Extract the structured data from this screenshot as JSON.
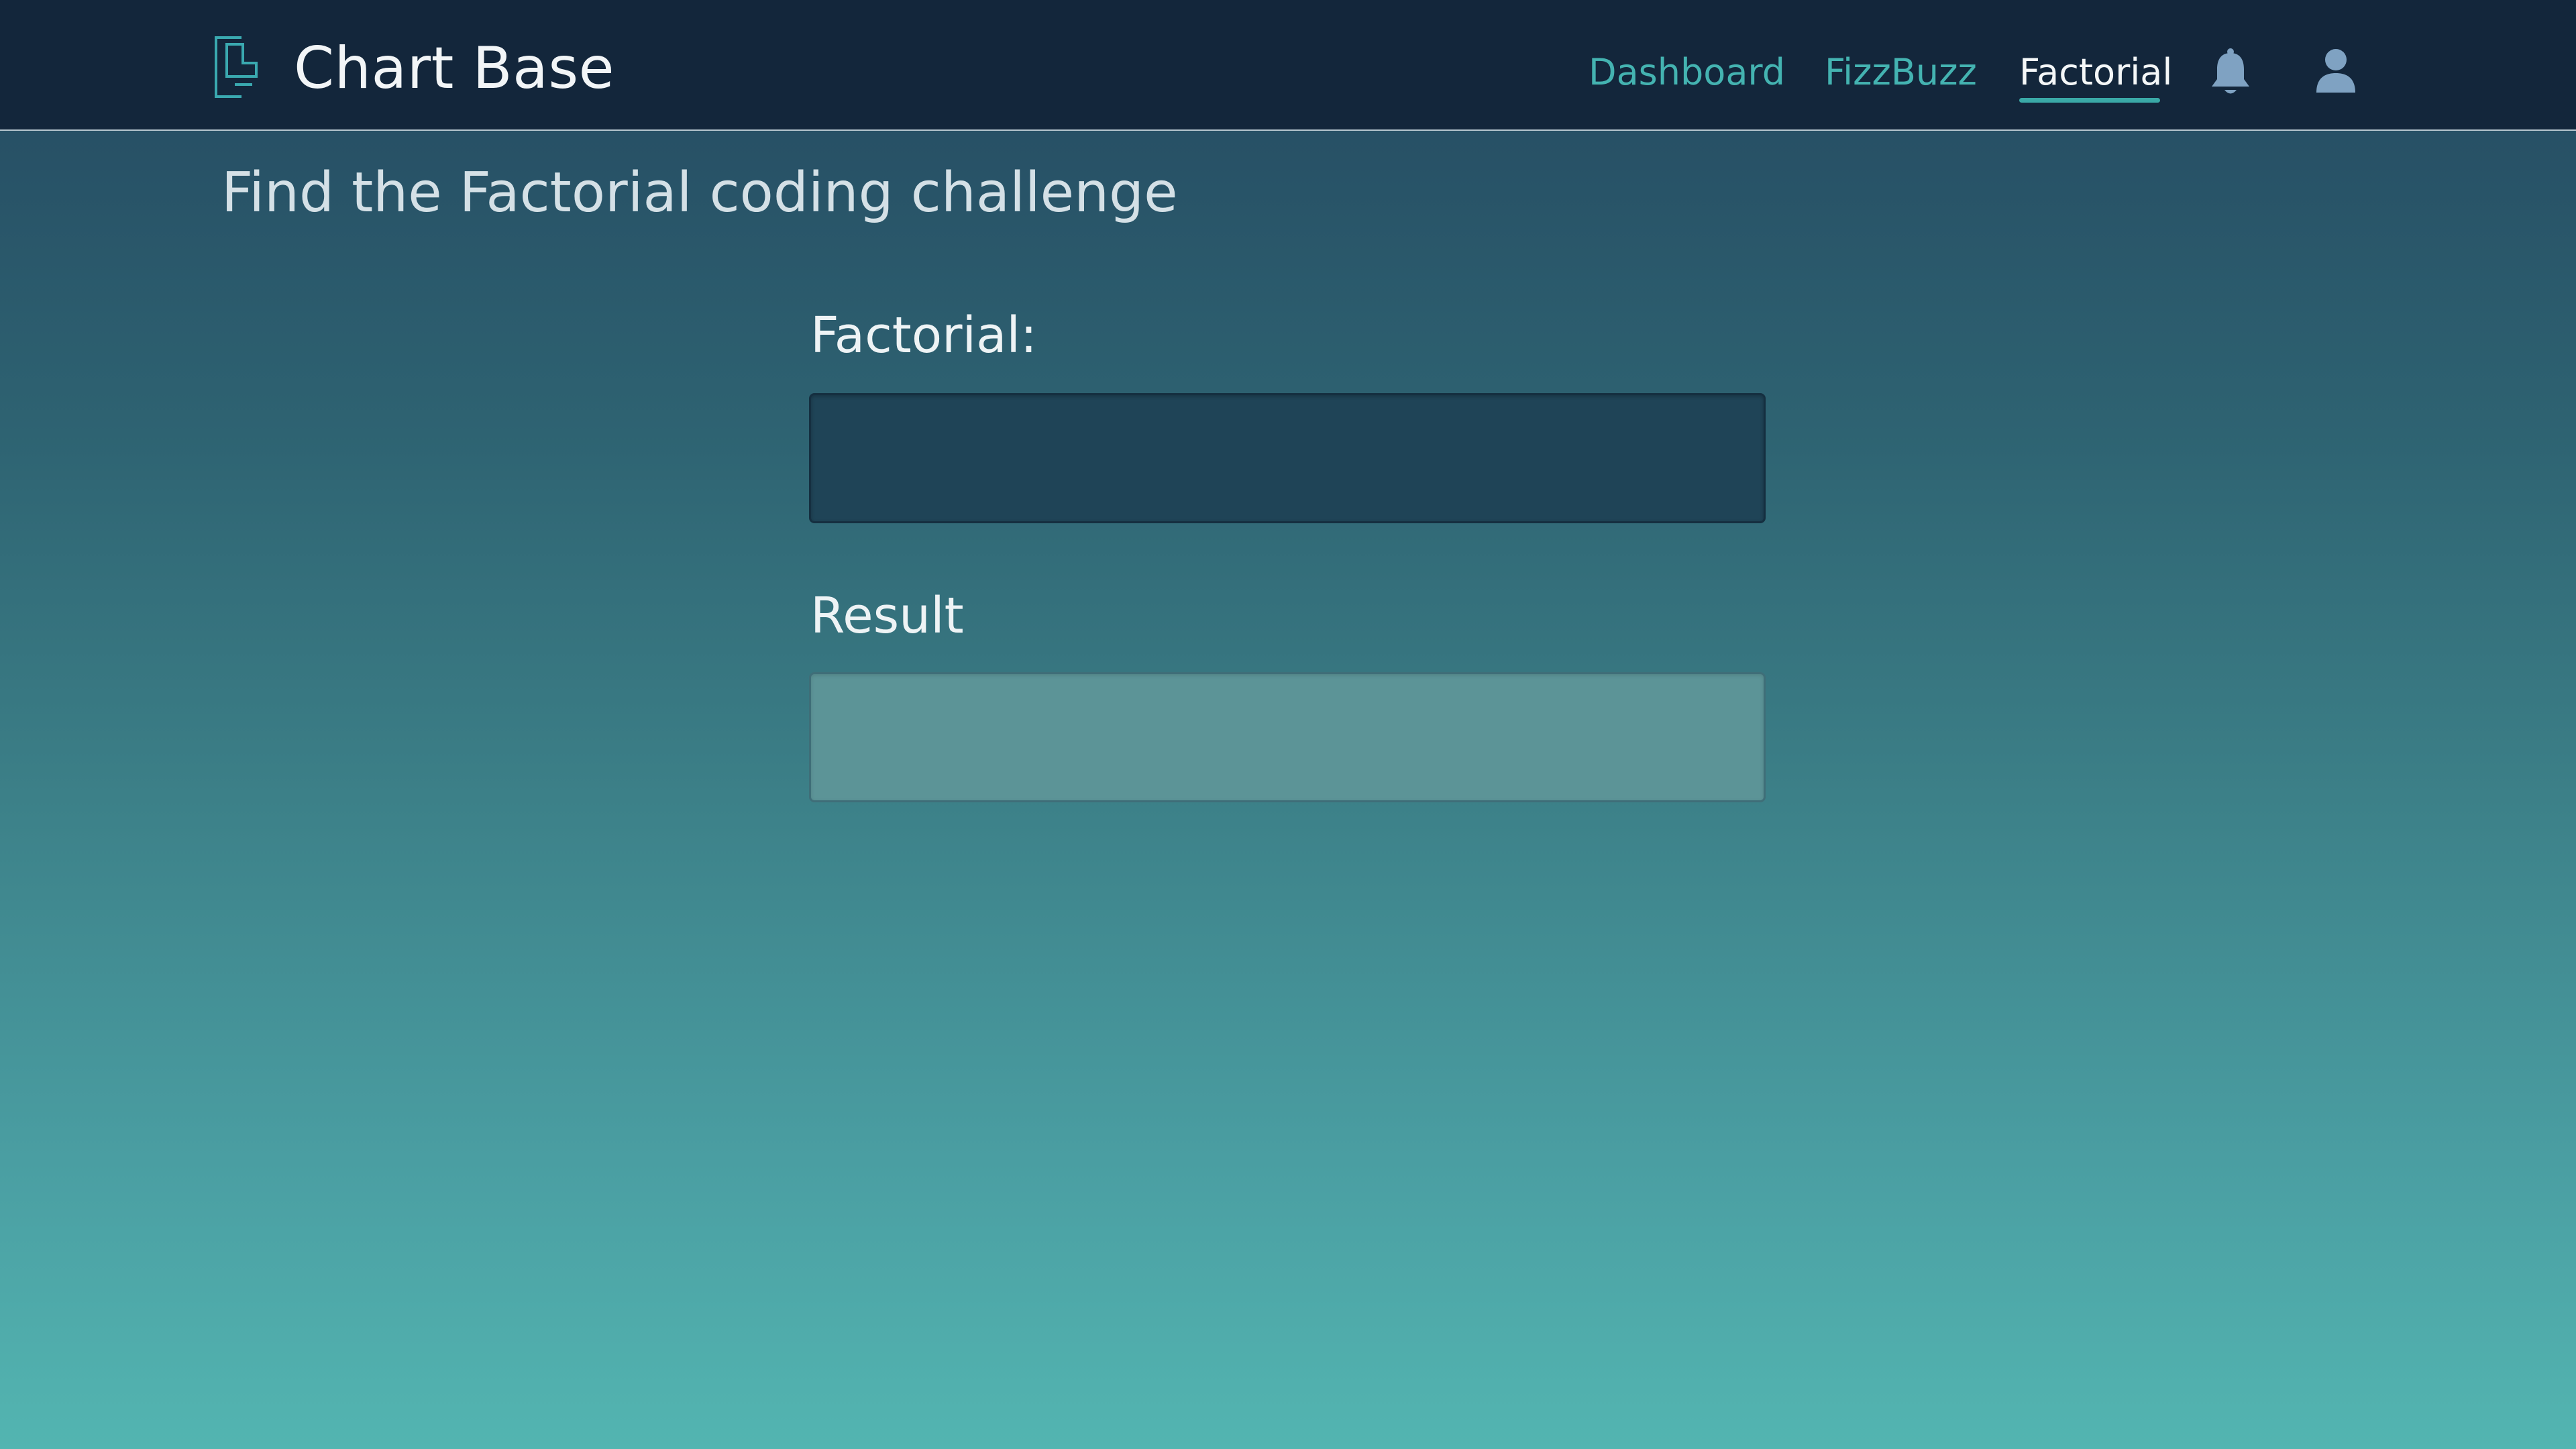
{
  "header": {
    "brand_icon": "ledger-bracket-icon",
    "title": "Chart Base",
    "nav": [
      {
        "label": "Dashboard",
        "active": false
      },
      {
        "label": "FizzBuzz",
        "active": false
      },
      {
        "label": "Factorial",
        "active": true
      }
    ],
    "icons": [
      "bell-icon",
      "user-icon"
    ]
  },
  "main": {
    "page_title": "Find the Factorial coding challenge",
    "factorial": {
      "label": "Factorial:",
      "value": "",
      "placeholder": ""
    },
    "result": {
      "label": "Result",
      "value": "",
      "placeholder": ""
    }
  },
  "colors": {
    "header_bg": "#13263b",
    "nav_link": "#44b3b1",
    "nav_active": "#f4f7f8",
    "gradient_top": "#244860",
    "gradient_bottom": "#53b5b1"
  }
}
